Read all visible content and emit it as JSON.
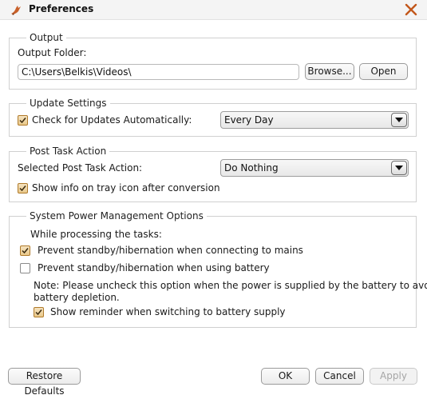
{
  "window": {
    "title": "Preferences",
    "app_icon": "fox-logo-icon",
    "close_icon": "close-x-icon"
  },
  "colors": {
    "checkbox_accent": "#e3b66a",
    "close_icon": "#c2571a"
  },
  "output": {
    "legend": "Output",
    "folder_label": "Output Folder:",
    "folder_value": "C:\\Users\\Belkis\\Videos\\",
    "browse_label": "Browse...",
    "open_label": "Open"
  },
  "update": {
    "legend": "Update Settings",
    "check_label": "Check for Updates Automatically:",
    "check_checked": true,
    "frequency_value": "Every Day"
  },
  "post_task": {
    "legend": "Post Task Action",
    "action_label": "Selected Post Task Action:",
    "action_value": "Do Nothing",
    "tray_label": "Show info on tray icon after conversion",
    "tray_checked": true
  },
  "power": {
    "legend": "System Power Management Options",
    "while_label": "While processing the tasks:",
    "mains_label": "Prevent standby/hibernation when connecting to mains",
    "mains_checked": true,
    "battery_label": "Prevent standby/hibernation when using battery",
    "battery_checked": false,
    "note_line1": "Note: Please uncheck this option when the power is supplied by the battery to avoid",
    "note_line2": "battery depletion.",
    "reminder_label": "Show reminder when switching to battery supply",
    "reminder_checked": true
  },
  "footer": {
    "restore_label": "Restore Defaults",
    "ok_label": "OK",
    "cancel_label": "Cancel",
    "apply_label": "Apply"
  }
}
